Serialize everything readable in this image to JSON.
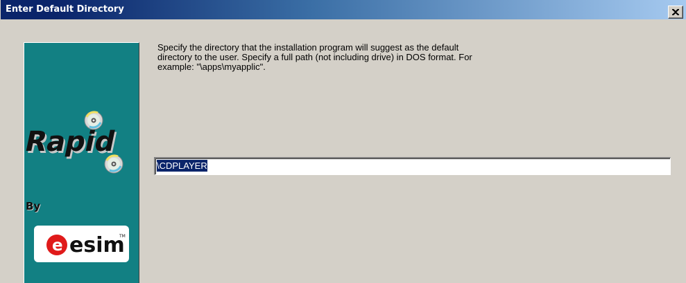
{
  "window": {
    "title": "Enter Default Directory"
  },
  "colors": {
    "title_active": "#0a246a",
    "title_fade": "#a6caf0",
    "dialog_bg": "#d4d0c8",
    "sidebar_bg": "#128083",
    "selection_bg": "#0a246a",
    "esim_red": "#e01a1a"
  },
  "icons": {
    "close": "close-icon",
    "cd": "cd-disc-icon"
  },
  "sidebar": {
    "product_logo_text": "Rapid",
    "by_label": "By",
    "company_logo_text": "esim",
    "company_logo_mark": "TM"
  },
  "main": {
    "description": "Specify the directory that the installation program will suggest as the default directory to the user. Specify a full path (not including drive) in DOS format. For example: \"\\apps\\myapplic\".",
    "directory_value": "\\CDPLAYER"
  }
}
